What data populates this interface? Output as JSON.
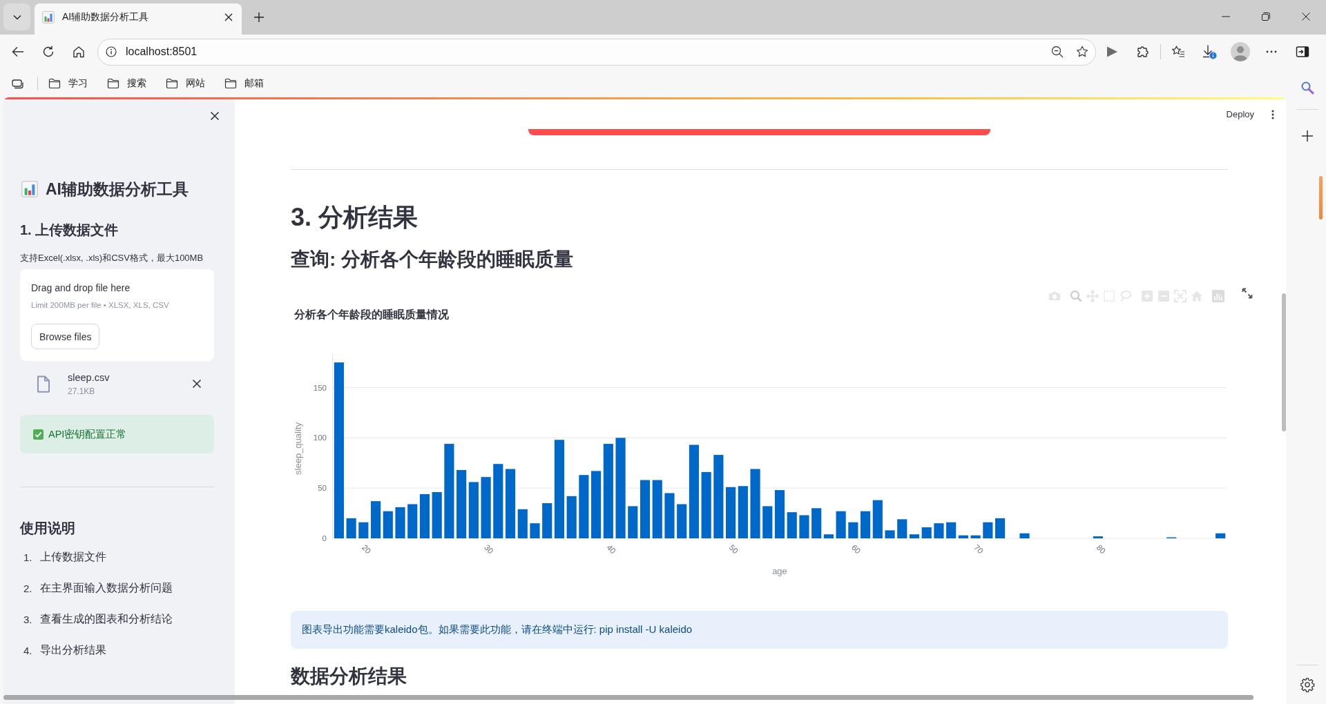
{
  "browser": {
    "tabs": [
      {
        "title": "AI辅助数据分析工具",
        "selected": true
      }
    ],
    "address": "localhost:8501",
    "bookmarks": [
      {
        "label": "学习"
      },
      {
        "label": "搜索"
      },
      {
        "label": "网站"
      },
      {
        "label": "邮箱"
      }
    ]
  },
  "sidebar": {
    "title": "AI辅助数据分析工具",
    "upload_heading": "1. 上传数据文件",
    "upload_hint": "支持Excel(.xlsx, .xls)和CSV格式，最大100MB",
    "dropzone": {
      "title": "Drag and drop file here",
      "limit": "Limit 200MB per file • XLSX, XLS, CSV",
      "button": "Browse files"
    },
    "file": {
      "name": "sleep.csv",
      "size": "27.1KB"
    },
    "alert": {
      "kind": "success",
      "text": "API密钥配置正常"
    },
    "help_heading": "使用说明",
    "help_steps": [
      {
        "number": "1.",
        "text": "上传数据文件"
      },
      {
        "number": "2.",
        "text": "在主界面输入数据分析问题"
      },
      {
        "number": "3.",
        "text": "查看生成的图表和分析结论"
      },
      {
        "number": "4.",
        "text": "导出分析结果"
      }
    ]
  },
  "header": {
    "deploy": "Deploy"
  },
  "main": {
    "heading": "3. 分析结果",
    "query": "查询: 分析各个年龄段的睡眠质量",
    "chart": {
      "chart_data": {
        "type": "bar",
        "title": "分析各个年龄段的睡眠质量情况",
        "xlabel": "age",
        "ylabel": "sleep_quality",
        "x": [
          18,
          19,
          20,
          21,
          22,
          23,
          24,
          25,
          26,
          27,
          28,
          29,
          30,
          31,
          32,
          33,
          34,
          35,
          36,
          37,
          38,
          39,
          40,
          41,
          42,
          43,
          44,
          45,
          46,
          47,
          48,
          49,
          50,
          51,
          52,
          53,
          54,
          55,
          56,
          57,
          58,
          59,
          60,
          61,
          62,
          63,
          64,
          65,
          66,
          67,
          68,
          69,
          70,
          71,
          72,
          74,
          80,
          86,
          90
        ],
        "values": [
          175,
          20,
          16,
          37,
          27,
          31,
          34,
          44,
          46,
          94,
          68,
          56,
          61,
          74,
          69,
          29,
          15,
          35,
          98,
          42,
          63,
          67,
          94,
          100,
          32,
          58,
          58,
          45,
          34,
          93,
          66,
          83,
          51,
          52,
          69,
          32,
          48,
          26,
          23,
          30,
          4,
          27,
          16,
          27,
          38,
          8,
          19,
          4,
          11,
          15,
          16,
          3,
          3,
          16,
          20,
          5,
          2,
          1,
          5
        ],
        "xlim": [
          17.5,
          90.5
        ],
        "ylim": [
          0,
          184
        ],
        "xticks": [
          20,
          30,
          40,
          50,
          60,
          70,
          80
        ],
        "yticks": [
          0,
          50,
          100,
          150
        ],
        "grid": true
      }
    },
    "notice": {
      "kind": "info",
      "text": "图表导出功能需要kaleido包。如果需要此功能，请在终端中运行: pip install -U kaleido"
    },
    "results_heading": "数据分析结果"
  }
}
